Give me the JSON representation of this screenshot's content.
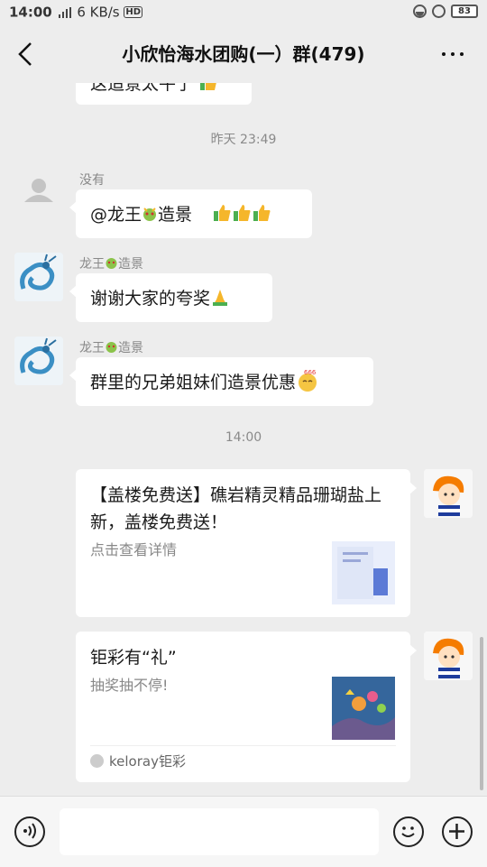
{
  "status": {
    "time": "14:00",
    "network": "6 KB/s",
    "battery": "83"
  },
  "header": {
    "title": "小欣怡海水团购(一）群(479)"
  },
  "messages": {
    "partial_top_text": "这造景太牛了",
    "time_yesterday": "昨天 23:49",
    "msg1": {
      "sender": "没有",
      "text_prefix": "@龙王",
      "text_suffix": "造景"
    },
    "msg2": {
      "sender": "龙王",
      "sender_suffix": "造景",
      "text": "谢谢大家的夸奖"
    },
    "msg3": {
      "sender": "龙王",
      "sender_suffix": "造景",
      "text": "群里的兄弟姐妹们造景优惠",
      "badge": "666"
    },
    "time_today": "14:00",
    "card1": {
      "title": "【盖楼免费送】礁岩精灵精品珊瑚盐上新，盖楼免费送！",
      "desc": "点击查看详情"
    },
    "card2": {
      "title": "钜彩有“礼”",
      "desc": "抽奖抽不停!",
      "source": "keloray钜彩"
    }
  },
  "colors": {
    "background": "#ededed",
    "bubble": "#ffffff",
    "thumb_yellow": "#f5b62b",
    "thumb_green": "#4caf50"
  }
}
